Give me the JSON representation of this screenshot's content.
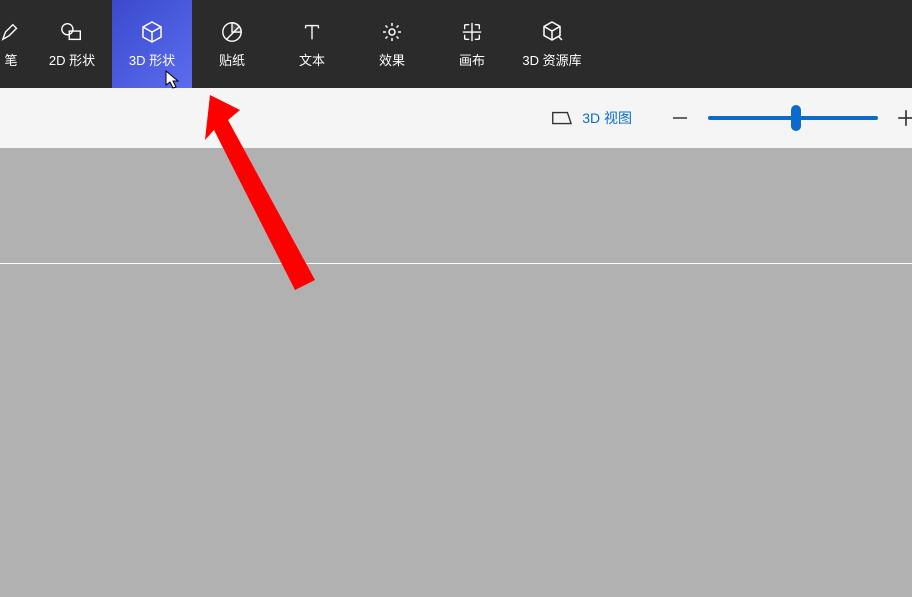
{
  "toolbar": {
    "items": [
      {
        "label": "笔",
        "icon": "pen"
      },
      {
        "label": "2D 形状",
        "icon": "shape-2d"
      },
      {
        "label": "3D 形状",
        "icon": "shape-3d",
        "active": true
      },
      {
        "label": "贴纸",
        "icon": "sticker"
      },
      {
        "label": "文本",
        "icon": "text"
      },
      {
        "label": "效果",
        "icon": "effects"
      },
      {
        "label": "画布",
        "icon": "canvas"
      },
      {
        "label": "3D 资源库",
        "icon": "library-3d"
      }
    ]
  },
  "subtoolbar": {
    "view_label": "3D 视图",
    "zoom": {
      "minus": "−",
      "plus": "+",
      "value": 52
    }
  }
}
